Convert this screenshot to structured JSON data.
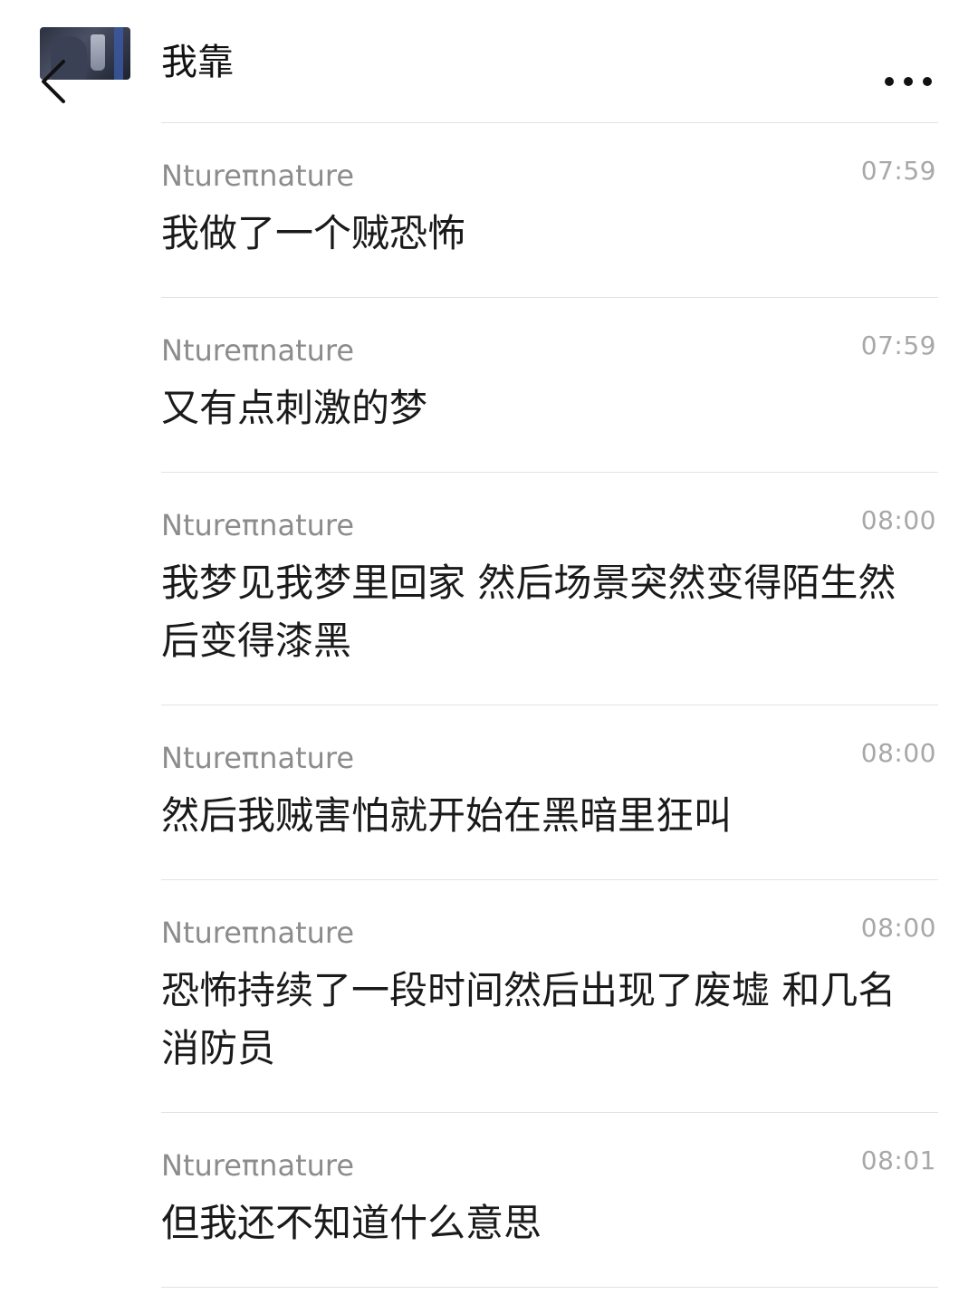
{
  "header": {
    "title": "我靠",
    "back_icon": "chevron-left-icon",
    "more_icon": "more-horizontal-icon",
    "avatar": "contact-avatar"
  },
  "messages": [
    {
      "sender": "Ntureπnature",
      "time": "07:59",
      "text": "我做了一个贼恐怖"
    },
    {
      "sender": "Ntureπnature",
      "time": "07:59",
      "text": "又有点刺激的梦"
    },
    {
      "sender": "Ntureπnature",
      "time": "08:00",
      "text": "我梦见我梦里回家 然后场景突然变得陌生然后变得漆黑"
    },
    {
      "sender": "Ntureπnature",
      "time": "08:00",
      "text": "然后我贼害怕就开始在黑暗里狂叫"
    },
    {
      "sender": "Ntureπnature",
      "time": "08:00",
      "text": "恐怖持续了一段时间然后出现了废墟 和几名消防员"
    },
    {
      "sender": "Ntureπnature",
      "time": "08:01",
      "text": "但我还不知道什么意思"
    }
  ]
}
